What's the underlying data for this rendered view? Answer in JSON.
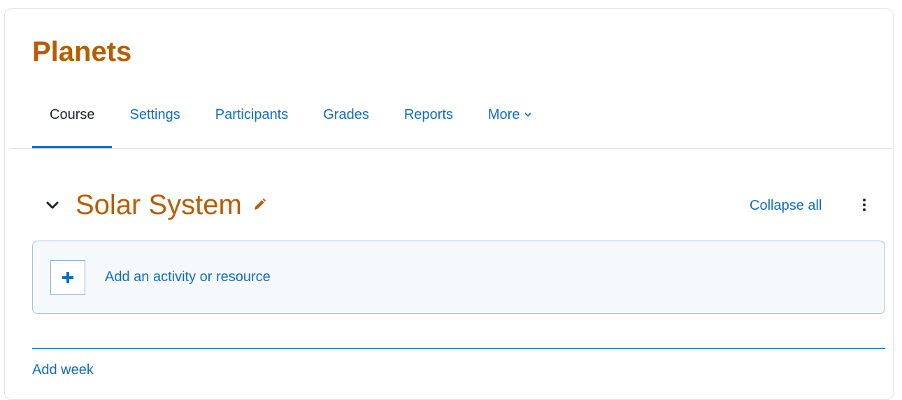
{
  "course": {
    "title": "Planets"
  },
  "tabs": [
    {
      "label": "Course",
      "active": true
    },
    {
      "label": "Settings"
    },
    {
      "label": "Participants"
    },
    {
      "label": "Grades"
    },
    {
      "label": "Reports"
    },
    {
      "label": "More"
    }
  ],
  "section": {
    "title": "Solar System",
    "collapse_all_label": "Collapse all",
    "add_activity_label": "Add an activity or resource"
  },
  "footer": {
    "add_week_label": "Add week"
  },
  "icons": {
    "collapse_toggle": "chevron-down-icon",
    "edit": "pencil-icon",
    "menu": "kebab-menu-icon",
    "add": "plus-icon",
    "more_dropdown": "chevron-down-icon"
  },
  "colors": {
    "title": "#b85c00",
    "link": "#0f6cbf",
    "text": "#1d2125",
    "border": "#dee2e6",
    "activity_bg": "#f5f9fc"
  }
}
